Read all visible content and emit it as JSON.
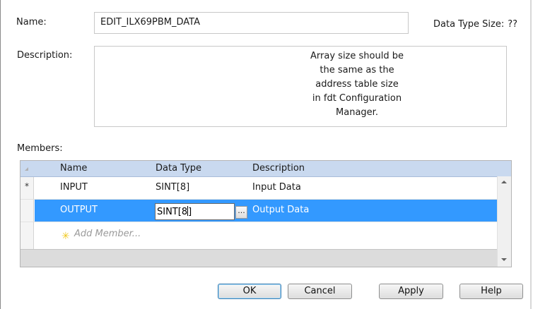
{
  "form": {
    "name_label": "Name:",
    "name_value": "EDIT_ILX69PBM_DATA",
    "data_type_size_label": "Data Type Size:",
    "data_type_size_value": "??",
    "description_label": "Description:",
    "description_lines": [
      "Array size should be",
      "the same as the",
      "address table size",
      "in fdt Configuration",
      "Manager."
    ],
    "members_label": "Members:"
  },
  "members_table": {
    "columns": [
      "Name",
      "Data Type",
      "Description"
    ],
    "rows": [
      {
        "marker": "*",
        "name": "INPUT",
        "data_type": "SINT[8]",
        "description": "Input Data"
      },
      {
        "marker": "",
        "name": "OUTPUT",
        "data_type": "SINT[8]",
        "description": "Output Data"
      }
    ],
    "editing_value": "SINT[8",
    "editing_value_tail": "]",
    "ellipsis_label": "...",
    "add_member_label": "Add Member..."
  },
  "buttons": {
    "ok": "OK",
    "cancel": "Cancel",
    "apply": "Apply",
    "help": "Help"
  },
  "colors": {
    "selection": "#3399ff",
    "header": "#c9d9ef"
  }
}
